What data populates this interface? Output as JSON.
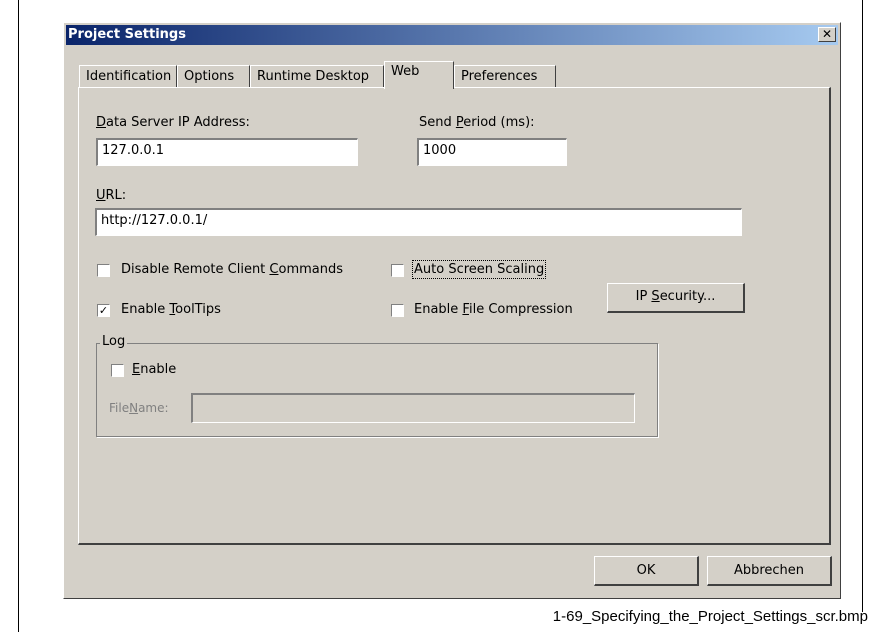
{
  "window": {
    "title": "Project Settings",
    "close_icon": "close-icon"
  },
  "tabs": [
    {
      "label": "Identification",
      "active": false
    },
    {
      "label": "Options",
      "active": false
    },
    {
      "label": "Runtime Desktop",
      "active": false
    },
    {
      "label": "Web",
      "active": true
    },
    {
      "label": "Preferences",
      "active": false
    }
  ],
  "web": {
    "data_server_ip": {
      "label_mnemonic": "D",
      "label_rest": "ata Server IP Address:",
      "value": "127.0.0.1"
    },
    "send_period": {
      "label_pre": "Send ",
      "label_mnemonic": "P",
      "label_rest": "eriod (ms):",
      "value": "1000"
    },
    "url": {
      "label_mnemonic": "U",
      "label_rest": "RL:",
      "value": "http://127.0.0.1/"
    },
    "disable_remote": {
      "label_pre": "Disable Remote Client ",
      "label_mnemonic": "C",
      "label_rest": "ommands",
      "checked": false
    },
    "enable_tooltips": {
      "label_pre": "Enable ",
      "label_mnemonic": "T",
      "label_rest": "oolTips",
      "checked": true
    },
    "auto_screen_scaling": {
      "label": "Auto Screen Scaling",
      "checked": false
    },
    "enable_file_compression": {
      "label_pre": "Enable ",
      "label_mnemonic": "F",
      "label_rest": "ile Compression",
      "checked": false
    },
    "ip_security": {
      "label_pre": "IP ",
      "label_mnemonic": "S",
      "label_rest": "ecurity..."
    },
    "log": {
      "group_label": "Log",
      "enable": {
        "label_mnemonic": "E",
        "label_rest": "nable",
        "checked": false
      },
      "filename": {
        "label_pre": "File",
        "label_mnemonic": "N",
        "label_rest": "ame:",
        "value": ""
      }
    }
  },
  "footer": {
    "ok_label": "OK",
    "cancel_label": "Abbrechen"
  },
  "caption": "1-69_Specifying_the_Project_Settings_scr.bmp",
  "colors": {
    "dialog_bg": "#d4d0c8",
    "title_start": "#0a246a",
    "title_end": "#a6caf0"
  }
}
